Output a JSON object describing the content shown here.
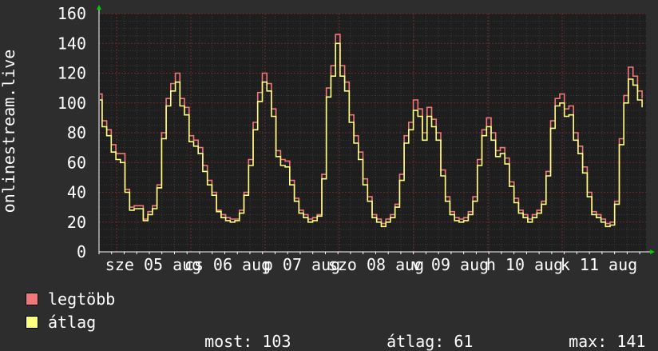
{
  "chart_data": {
    "type": "line",
    "ylabel": "onlinestream.live",
    "ylim": [
      0,
      160
    ],
    "yticks": [
      0,
      20,
      40,
      60,
      80,
      100,
      120,
      140,
      160
    ],
    "xtick_labels": [
      "sze 05 aug",
      "cs 06 aug",
      "p 07 aug",
      "szo 08 aug",
      "v 09 aug",
      "h 10 aug",
      "k 11 aug"
    ],
    "grid": true,
    "colors": {
      "background": "#2d2d2d",
      "plot_bg": "#1e1e1e",
      "grid": "#6b2a2a",
      "max_line": "#f07878",
      "avg_line": "#ffff80",
      "axis_arrow": "#00cc00"
    },
    "series": [
      {
        "name": "legtöbb",
        "color": "#f07878",
        "values": [
          106,
          88,
          82,
          72,
          66,
          66,
          42,
          30,
          31,
          31,
          22,
          27,
          31,
          45,
          80,
          103,
          113,
          120,
          103,
          97,
          78,
          75,
          70,
          58,
          48,
          40,
          28,
          25,
          23,
          22,
          22,
          28,
          40,
          62,
          87,
          107,
          120,
          113,
          96,
          68,
          62,
          61,
          48,
          36,
          28,
          25,
          22,
          23,
          25,
          52,
          110,
          125,
          146,
          125,
          114,
          92,
          78,
          67,
          49,
          37,
          25,
          22,
          19,
          22,
          25,
          32,
          52,
          78,
          87,
          102,
          96,
          80,
          97,
          89,
          80,
          55,
          37,
          27,
          23,
          22,
          23,
          27,
          37,
          62,
          82,
          90,
          80,
          68,
          70,
          63,
          47,
          36,
          28,
          25,
          22,
          25,
          28,
          34,
          54,
          88,
          103,
          106,
          96,
          98,
          80,
          71,
          57,
          40,
          27,
          25,
          22,
          19,
          20,
          34,
          76,
          105,
          124,
          118,
          108,
          103
        ]
      },
      {
        "name": "átlag",
        "color": "#ffff80",
        "values": [
          102,
          84,
          78,
          67,
          62,
          60,
          40,
          28,
          29,
          29,
          21,
          25,
          29,
          43,
          76,
          98,
          108,
          114,
          98,
          92,
          74,
          71,
          66,
          54,
          45,
          38,
          27,
          23,
          21,
          20,
          21,
          26,
          38,
          58,
          82,
          101,
          114,
          108,
          91,
          64,
          58,
          57,
          45,
          34,
          26,
          23,
          20,
          21,
          24,
          49,
          104,
          118,
          140,
          118,
          108,
          87,
          73,
          62,
          45,
          34,
          23,
          20,
          17,
          20,
          23,
          30,
          48,
          73,
          82,
          95,
          91,
          75,
          91,
          84,
          75,
          51,
          34,
          25,
          21,
          20,
          21,
          25,
          34,
          58,
          78,
          84,
          75,
          64,
          66,
          59,
          44,
          33,
          26,
          23,
          20,
          23,
          26,
          32,
          51,
          83,
          98,
          100,
          91,
          92,
          75,
          66,
          53,
          37,
          25,
          23,
          20,
          17,
          18,
          32,
          72,
          100,
          116,
          112,
          102,
          97
        ]
      }
    ],
    "legend": {
      "max_label": "legtöbb",
      "avg_label": "átlag",
      "stats": [
        {
          "label": "most:",
          "value": "103"
        },
        {
          "label": "átlag:",
          "value": "61"
        },
        {
          "label": "max:",
          "value": "141"
        }
      ]
    }
  }
}
